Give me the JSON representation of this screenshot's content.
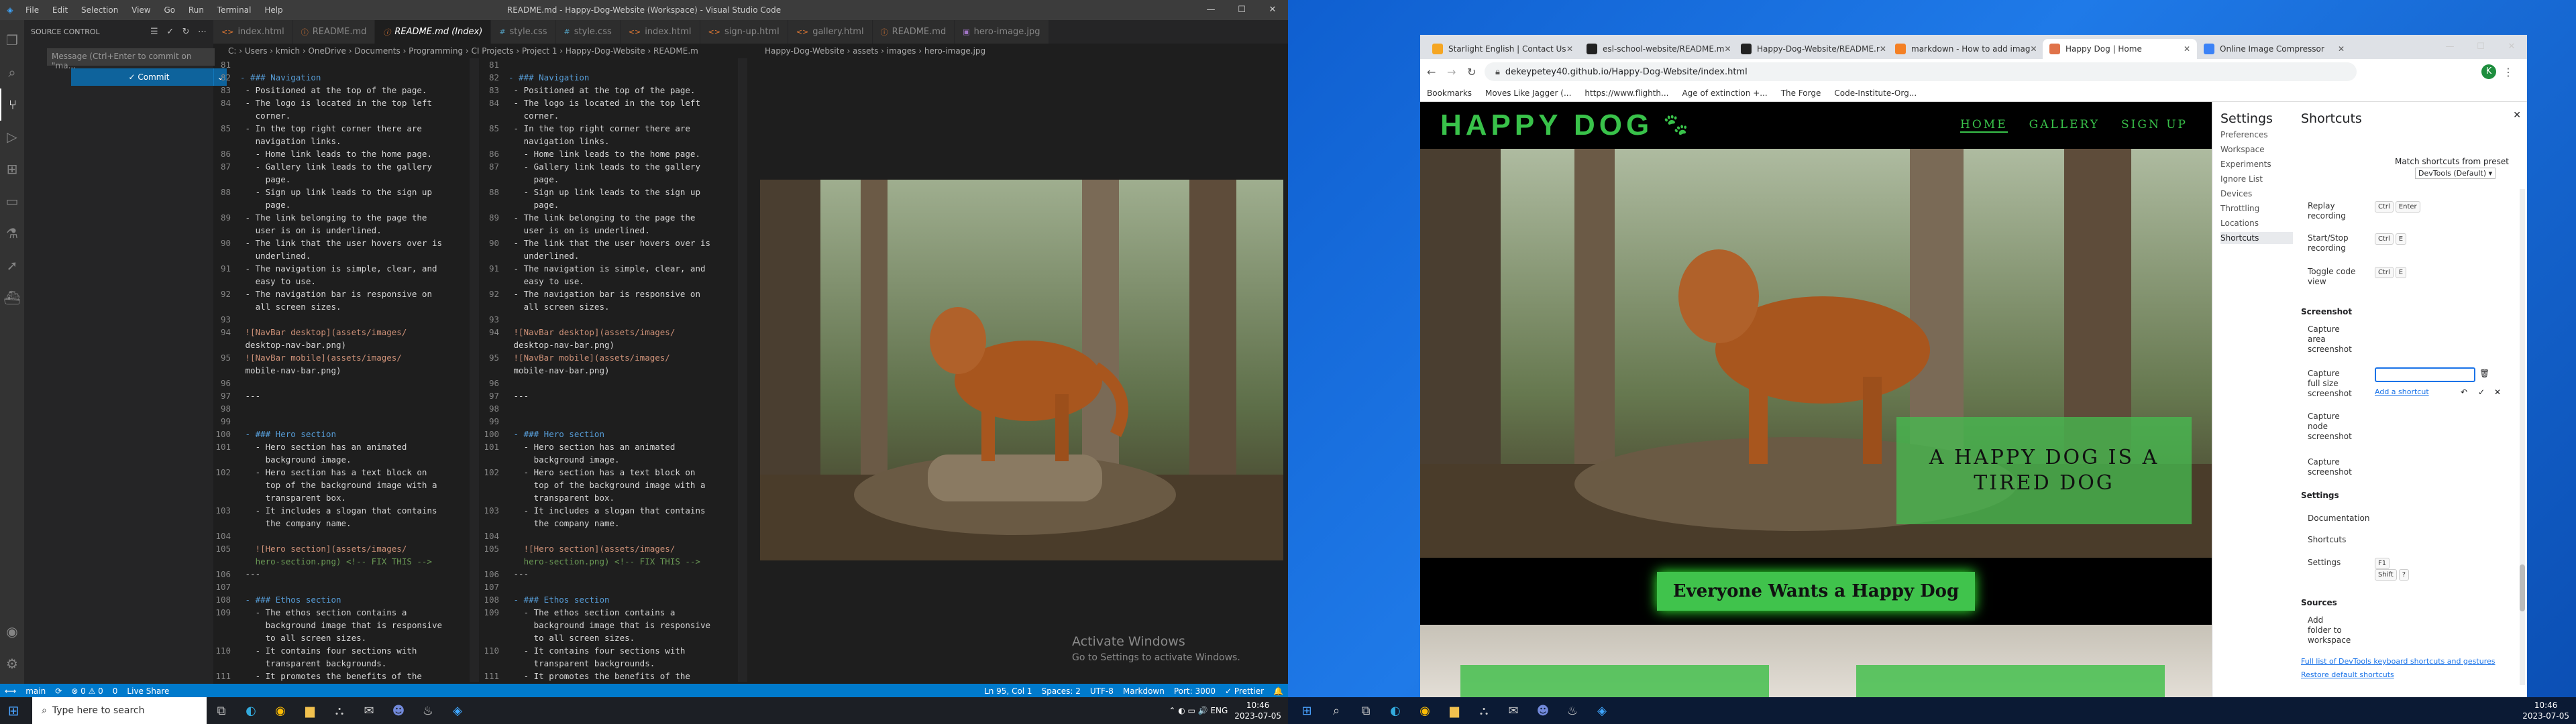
{
  "vscode": {
    "title": "README.md - Happy-Dog-Website (Workspace) - Visual Studio Code",
    "menu": [
      "File",
      "Edit",
      "Selection",
      "View",
      "Go",
      "Run",
      "Terminal",
      "Help"
    ],
    "sidebar_title": "SOURCE CONTROL",
    "commit_placeholder": "Message (Ctrl+Enter to commit on \"ma...",
    "commit_label": "✓ Commit",
    "tabs": [
      {
        "label": "index.html",
        "kind": "html",
        "active": false
      },
      {
        "label": "README.md",
        "kind": "md",
        "active": false
      },
      {
        "label": "README.md (Index)",
        "kind": "md",
        "active": true
      },
      {
        "label": "style.css",
        "kind": "css",
        "active": false
      },
      {
        "label": "style.css",
        "kind": "css",
        "active": false
      },
      {
        "label": "index.html",
        "kind": "html",
        "active": false
      },
      {
        "label": "sign-up.html",
        "kind": "html",
        "active": false
      },
      {
        "label": "gallery.html",
        "kind": "html",
        "active": false
      },
      {
        "label": "README.md",
        "kind": "md",
        "active": false
      },
      {
        "label": "hero-image.jpg",
        "kind": "img",
        "active": false
      }
    ],
    "breadcrumb_left": "C: › Users › kmich › OneDrive › Documents › Programming › CI Projects › Project 1 › Happy-Dog-Website › README.md › # Happy Dog",
    "breadcrumb_right": "Happy-Dog-Website › assets › images › hero-image.jpg",
    "editor_lines": [
      {
        "n": "81",
        "t": "",
        "k": "p"
      },
      {
        "n": "82",
        "t": "- ### Navigation",
        "k": "h"
      },
      {
        "n": "83",
        "t": " - Positioned at the top of the page.",
        "k": "p"
      },
      {
        "n": "84",
        "t": " - The logo is located in the top left",
        "k": "p"
      },
      {
        "n": "",
        "t": "   corner.",
        "k": "p"
      },
      {
        "n": "85",
        "t": " - In the top right corner there are",
        "k": "p"
      },
      {
        "n": "",
        "t": "   navigation links.",
        "k": "p"
      },
      {
        "n": "86",
        "t": "   - Home link leads to the home page.",
        "k": "p"
      },
      {
        "n": "87",
        "t": "   - Gallery link leads to the gallery",
        "k": "p"
      },
      {
        "n": "",
        "t": "     page.",
        "k": "p"
      },
      {
        "n": "88",
        "t": "   - Sign up link leads to the sign up",
        "k": "p"
      },
      {
        "n": "",
        "t": "     page.",
        "k": "p"
      },
      {
        "n": "89",
        "t": " - The link belonging to the page the",
        "k": "p"
      },
      {
        "n": "",
        "t": "   user is on is underlined.",
        "k": "p"
      },
      {
        "n": "90",
        "t": " - The link that the user hovers over is",
        "k": "p"
      },
      {
        "n": "",
        "t": "   underlined.",
        "k": "p"
      },
      {
        "n": "91",
        "t": " - The navigation is simple, clear, and",
        "k": "p"
      },
      {
        "n": "",
        "t": "   easy to use.",
        "k": "p"
      },
      {
        "n": "92",
        "t": " - The navigation bar is responsive on",
        "k": "p"
      },
      {
        "n": "",
        "t": "   all screen sizes.",
        "k": "p"
      },
      {
        "n": "93",
        "t": "",
        "k": "p"
      },
      {
        "n": "94",
        "t": " ![NavBar desktop](assets/images/",
        "k": "l"
      },
      {
        "n": "",
        "t": " desktop-nav-bar.png)",
        "k": "p"
      },
      {
        "n": "95",
        "t": " ![NavBar mobile](assets/images/",
        "k": "l"
      },
      {
        "n": "",
        "t": " mobile-nav-bar.png)",
        "k": "p"
      },
      {
        "n": "96",
        "t": "",
        "k": "p"
      },
      {
        "n": "97",
        "t": " ---",
        "k": "p"
      },
      {
        "n": "98",
        "t": "",
        "k": "p"
      },
      {
        "n": "99",
        "t": "",
        "k": "p"
      },
      {
        "n": "100",
        "t": " - ### Hero section",
        "k": "h"
      },
      {
        "n": "101",
        "t": "   - Hero section has an animated",
        "k": "p"
      },
      {
        "n": "",
        "t": "     background image.",
        "k": "p"
      },
      {
        "n": "102",
        "t": "   - Hero section has a text block on",
        "k": "p"
      },
      {
        "n": "",
        "t": "     top of the background image with a",
        "k": "p"
      },
      {
        "n": "",
        "t": "     transparent box.",
        "k": "p"
      },
      {
        "n": "103",
        "t": "   - It includes a slogan that contains",
        "k": "p"
      },
      {
        "n": "",
        "t": "     the company name.",
        "k": "p"
      },
      {
        "n": "104",
        "t": "",
        "k": "p"
      },
      {
        "n": "105",
        "t": "   ![Hero section](assets/images/",
        "k": "l"
      },
      {
        "n": "",
        "t": "   hero-section.png) <!-- FIX THIS -->",
        "k": "c"
      },
      {
        "n": "106",
        "t": " ---",
        "k": "p"
      },
      {
        "n": "107",
        "t": "",
        "k": "p"
      },
      {
        "n": "108",
        "t": " - ### Ethos section",
        "k": "h"
      },
      {
        "n": "109",
        "t": "   - The ethos section contains a",
        "k": "p"
      },
      {
        "n": "",
        "t": "     background image that is responsive",
        "k": "p"
      },
      {
        "n": "",
        "t": "     to all screen sizes.",
        "k": "p"
      },
      {
        "n": "110",
        "t": "   - It contains four sections with",
        "k": "p"
      },
      {
        "n": "",
        "t": "     transparent backgrounds.",
        "k": "p"
      },
      {
        "n": "111",
        "t": "   - It promotes the benefits of the",
        "k": "p"
      }
    ],
    "activate_title": "Activate Windows",
    "activate_sub": "Go to Settings to activate Windows.",
    "status": {
      "branch": "main",
      "sync": "⟳",
      "problems": "⊗ 0 ⚠ 0",
      "ports": "0",
      "live": "Live Share",
      "pos": "Ln 95, Col 1",
      "spaces": "Spaces: 2",
      "enc": "UTF-8",
      "lang": "Markdown",
      "port": "Port: 3000",
      "prettier": "✓ Prettier"
    },
    "taskbar_search": "Type here to search",
    "time": "10:46",
    "date": "2023-07-05"
  },
  "chrome": {
    "tabs": [
      {
        "label": "Starlight English | Contact Us",
        "color": "#f5a623",
        "active": false
      },
      {
        "label": "esl-school-website/README.m",
        "color": "#222",
        "active": false
      },
      {
        "label": "Happy-Dog-Website/README.r",
        "color": "#222",
        "active": false
      },
      {
        "label": "markdown - How to add imag",
        "color": "#f48024",
        "active": false
      },
      {
        "label": "Happy Dog | Home",
        "color": "#e0734a",
        "active": true
      },
      {
        "label": "Online Image Compressor",
        "color": "#3b82f6",
        "active": false
      }
    ],
    "url": "dekeypetey40.github.io/Happy-Dog-Website/index.html",
    "bookmarks": [
      "Bookmarks",
      "Moves Like Jagger (...",
      "https://www.flighth...",
      "Age of extinction +...",
      "The Forge",
      "Code-Institute-Org..."
    ]
  },
  "site": {
    "brand": "HAPPY DOG",
    "nav": [
      "HOME",
      "GALLERY",
      "SIGN UP"
    ],
    "slogan": "A HAPPY DOG IS A TIRED DOG",
    "ethos": "Everyone Wants a Happy Dog"
  },
  "devtools": {
    "settings_title": "Settings",
    "nav": [
      "Preferences",
      "Workspace",
      "Experiments",
      "Ignore List",
      "Devices",
      "Throttling",
      "Locations",
      "Shortcuts"
    ],
    "shortcuts_title": "Shortcuts",
    "match_label": "Match shortcuts from preset",
    "preset": "DevTools (Default)",
    "replay": "Replay recording",
    "startstop": "Start/Stop recording",
    "toggle": "Toggle code view",
    "screenshot_head": "Screenshot",
    "cap_area": "Capture area screenshot",
    "cap_full": "Capture full size screenshot",
    "add_shortcut": "Add a shortcut",
    "cap_node": "Capture node screenshot",
    "cap_shot": "Capture screenshot",
    "settings_head": "Settings",
    "documentation": "Documentation",
    "shortcuts": "Shortcuts",
    "settings_item": "Settings",
    "sources_head": "Sources",
    "add_folder": "Add folder to workspace",
    "full_list": "Full list of DevTools keyboard shortcuts and gestures",
    "restore": "Restore default shortcuts",
    "keys": {
      "ctrl": "Ctrl",
      "enter": "Enter",
      "e": "E",
      "f1": "F1",
      "shift": "Shift",
      "q": "?"
    }
  },
  "taskbar2": {
    "time": "10:46",
    "date": "2023-07-05"
  }
}
